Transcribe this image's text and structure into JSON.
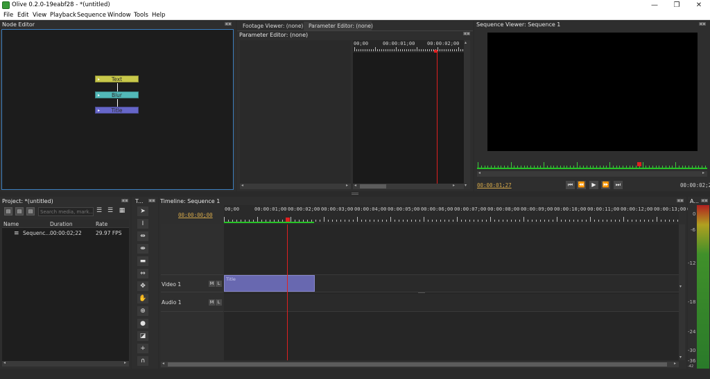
{
  "window": {
    "title": "Olive 0.2.0-19eabf28 - *(untitled)",
    "minimize": "—",
    "maximize": "❐",
    "close": "✕"
  },
  "menu": [
    "File",
    "Edit",
    "View",
    "Playback",
    "Sequence",
    "Window",
    "Tools",
    "Help"
  ],
  "node_editor": {
    "title": "Node Editor",
    "nodes": [
      {
        "label": "Text",
        "color": "#c8c84a"
      },
      {
        "label": "Blur",
        "color": "#52b8b8"
      },
      {
        "label": "Title",
        "color": "#6666c8"
      }
    ]
  },
  "viewer_tabs": {
    "tabs": [
      "Footage Viewer: (none)",
      "Parameter Editor: (none)"
    ],
    "active": 1
  },
  "parameter_editor": {
    "title": "Parameter Editor: (none)",
    "ruler": [
      "00;00",
      "00:00:01;00",
      "00:00:02;00"
    ]
  },
  "sequence_viewer": {
    "title": "Sequence Viewer: Sequence 1",
    "current_time": "00:00:01;27",
    "duration": "00:00:02;22",
    "buttons": [
      "go-to-start",
      "rewind",
      "play",
      "fast-forward",
      "go-to-end"
    ]
  },
  "project": {
    "title": "Project: *(untitled)",
    "search_placeholder": "Search media, mark...",
    "columns": [
      "Name",
      "Duration",
      "Rate"
    ],
    "rows": [
      {
        "name": "Sequenc...",
        "duration": "00:00:02;22",
        "rate": "29.97 FPS"
      }
    ]
  },
  "tools": {
    "title": "T...",
    "icons": [
      "pointer-tool-icon",
      "edit-tool-icon",
      "ripple-tool-icon",
      "rolling-tool-icon",
      "razor-tool-icon",
      "slip-tool-icon",
      "slide-tool-icon",
      "hand-tool-icon",
      "zoom-tool-icon",
      "record-tool-icon",
      "transition-tool-icon",
      "add-tool-icon",
      "snapping-toggle-icon"
    ]
  },
  "timeline": {
    "title": "Timeline: Sequence 1",
    "current_time": "00:00:00;00",
    "ruler": [
      "00;00",
      "00:00:01;00",
      "00:00:02;00",
      "00:00:03;00",
      "00:00:04;00",
      "00:00:05;00",
      "00:00:06;00",
      "00:00:07;00",
      "00:00:08;00",
      "00:00:09;00",
      "00:00:10;00",
      "00:00:11;00",
      "00:00:12;00",
      "00:00:13;00",
      "00:"
    ],
    "tracks": [
      {
        "name": "Video 1",
        "m": "M",
        "l": "L"
      },
      {
        "name": "Audio 1",
        "m": "M",
        "l": "L"
      }
    ],
    "clip": {
      "label": "Title",
      "color": "#6868b0"
    }
  },
  "audio_meter": {
    "title": "A...",
    "labels": [
      "0",
      "-6",
      "-12",
      "-18",
      "-24",
      "-30",
      "-36",
      "-42"
    ]
  }
}
